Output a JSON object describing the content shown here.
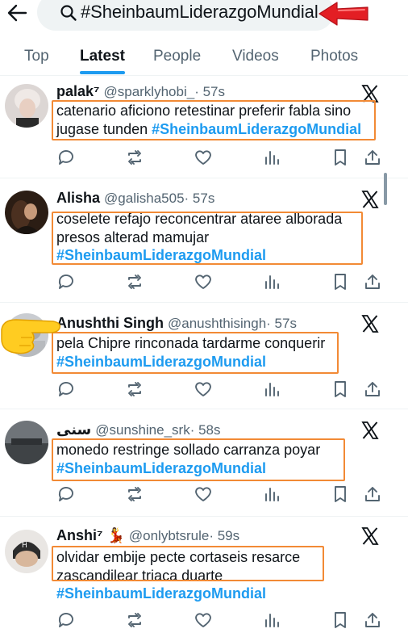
{
  "search": {
    "query": "#SheinbaumLiderazgoMundial"
  },
  "tabs": [
    {
      "label": "Top"
    },
    {
      "label": "Latest"
    },
    {
      "label": "People"
    },
    {
      "label": "Videos"
    },
    {
      "label": "Photos"
    }
  ],
  "active_tab": "Latest",
  "colors": {
    "accent": "#1d9bf0",
    "highlight_box": "#f28a35",
    "annotation_arrow": "#e31e24"
  },
  "tweets": [
    {
      "name": "palak⁷",
      "handle": "@sparklyhobi_",
      "time": "· 57s",
      "lines": [
        "catenario aficiono retestinar preferir fabla sino",
        "jugase tunden"
      ],
      "hashtag": "#SheinbaumLiderazgoMundial",
      "hashtag_inline": true
    },
    {
      "name": "Alisha",
      "handle": "@galisha505",
      "time": "· 57s",
      "lines": [
        "coselete refajo reconcentrar ataree alborada",
        "presos alterad mamujar"
      ],
      "hashtag": "#SheinbaumLiderazgoMundial",
      "hashtag_inline": false
    },
    {
      "name": "Anushthi Singh",
      "handle": "@anushthisingh",
      "time": "· 57s",
      "lines": [
        "pela Chipre rinconada tardarme conquerir"
      ],
      "hashtag": "#SheinbaumLiderazgoMundial",
      "hashtag_inline": false
    },
    {
      "name": "سنی",
      "handle": "@sunshine_srk",
      "time": "· 58s",
      "lines": [
        "monedo restringe sollado carranza poyar"
      ],
      "hashtag": "#SheinbaumLiderazgoMundial",
      "hashtag_inline": false
    },
    {
      "name": "Anshi⁷",
      "handle": "@onlybtsrule",
      "time": "· 59s",
      "lines": [
        "olvidar embije pecte cortaseis resarce",
        "zascandilear triaca duarte"
      ],
      "hashtag": "#SheinbaumLiderazgoMundial",
      "hashtag_inline": false
    }
  ]
}
